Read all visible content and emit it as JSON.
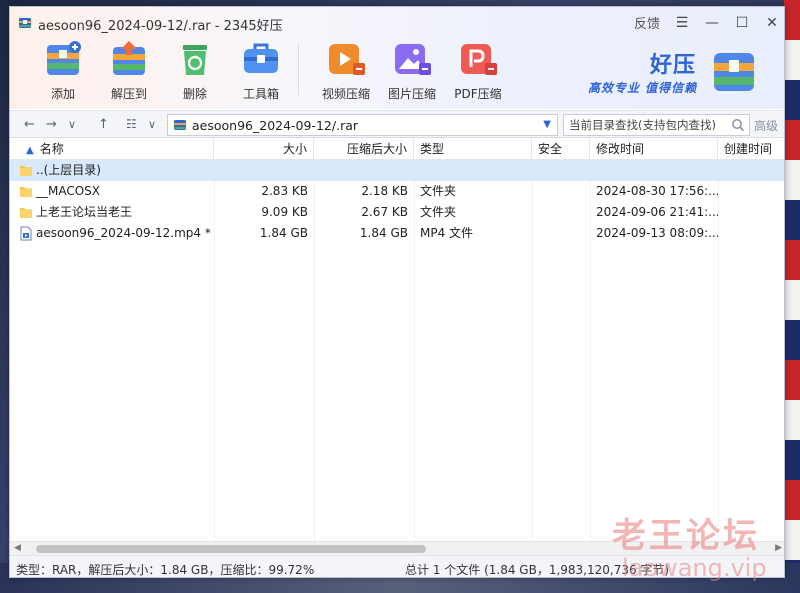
{
  "window": {
    "title": "aesoon96_2024-09-12/.rar - 2345好压",
    "feedback_label": "反馈"
  },
  "toolbar": {
    "items": [
      {
        "label": "添加",
        "icon": "add-archive-icon"
      },
      {
        "label": "解压到",
        "icon": "extract-to-icon"
      },
      {
        "label": "删除",
        "icon": "recycle-delete-icon"
      },
      {
        "label": "工具箱",
        "icon": "toolbox-icon"
      },
      {
        "label": "视频压缩",
        "icon": "video-compress-icon"
      },
      {
        "label": "图片压缩",
        "icon": "image-compress-icon"
      },
      {
        "label": "PDF压缩",
        "icon": "pdf-compress-icon"
      }
    ]
  },
  "brand": {
    "name": "好压",
    "slogan": "高效专业  值得信赖"
  },
  "address": {
    "path": "aesoon96_2024-09-12/.rar",
    "search_placeholder": "当前目录查找(支持包内查找)",
    "advanced_label": "高级"
  },
  "table": {
    "columns": {
      "name": "名称",
      "size": "大小",
      "packed": "压缩后大小",
      "type": "类型",
      "secure": "安全",
      "modified": "修改时间",
      "created": "创建时间"
    },
    "rows": [
      {
        "name": "..(上层目录)",
        "size": "",
        "packed": "",
        "type": "",
        "secure": "",
        "modified": "",
        "icon": "folder-icon",
        "selected": true
      },
      {
        "name": "__MACOSX",
        "size": "2.83 KB",
        "packed": "2.18 KB",
        "type": "文件夹",
        "secure": "",
        "modified": "2024-08-30 17:56:...",
        "icon": "folder-icon",
        "selected": false
      },
      {
        "name": "上老王论坛当老王",
        "size": "9.09 KB",
        "packed": "2.67 KB",
        "type": "文件夹",
        "secure": "",
        "modified": "2024-09-06 21:41:...",
        "icon": "folder-icon",
        "selected": false
      },
      {
        "name": "aesoon96_2024-09-12.mp4 *",
        "size": "1.84 GB",
        "packed": "1.84 GB",
        "type": "MP4 文件",
        "secure": "",
        "modified": "2024-09-13 08:09:...",
        "icon": "video-file-icon",
        "selected": false
      }
    ]
  },
  "status": {
    "left": "类型：RAR，解压后大小：1.84 GB，压缩比：99.72%",
    "right": "总计 1 个文件 (1.84 GB，1,983,120,736 字节)"
  },
  "watermark": {
    "line1": "老王论坛",
    "line2": "laowang.vip"
  },
  "colors": {
    "accent": "#2e64d8",
    "selection": "#d9e8fb"
  }
}
